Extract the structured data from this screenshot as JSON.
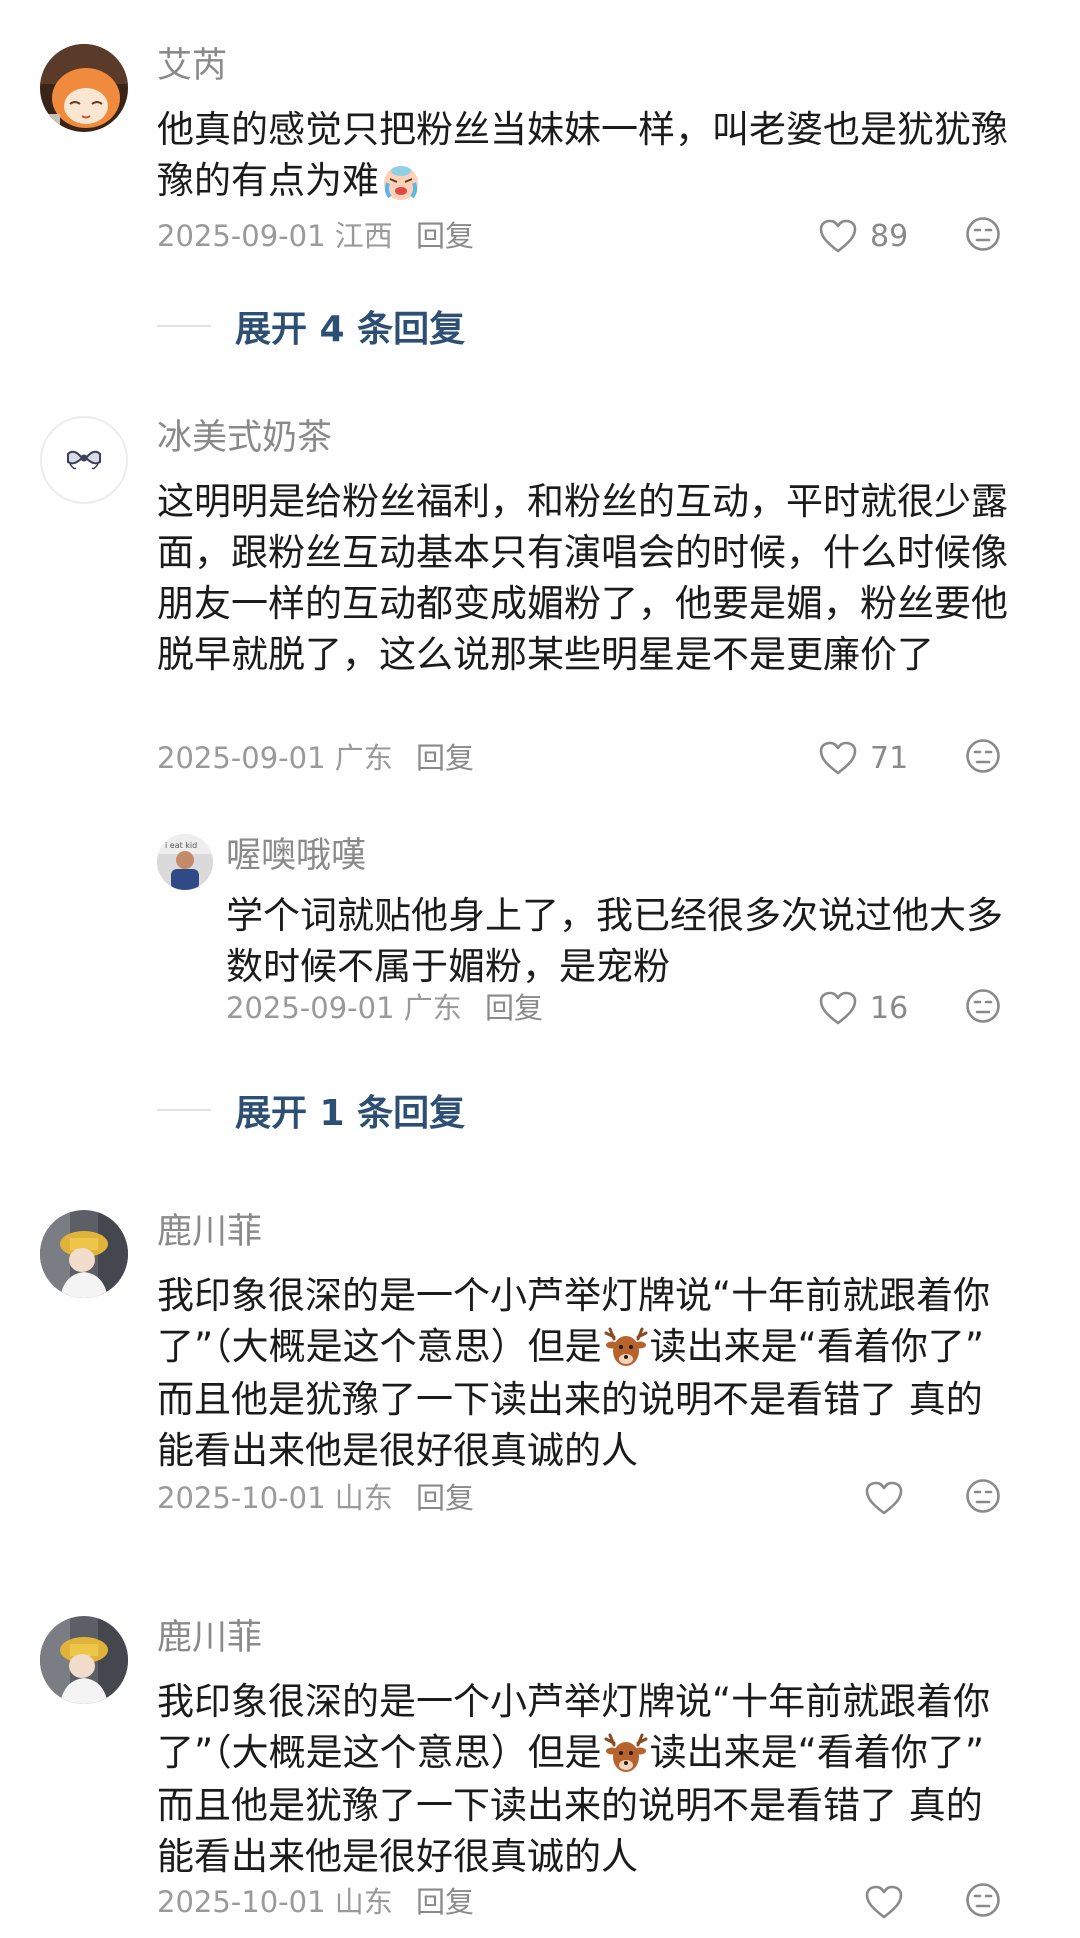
{
  "comments": [
    {
      "username": "艾芮",
      "content_parts": [
        "他真的感觉只把粉丝当妹妹一样，叫老婆也是犹犹豫豫的有点为难"
      ],
      "emoji": "crying-face",
      "date": "2025-09-01",
      "location": "江西",
      "reply_label": "回复",
      "likes": "89",
      "expand_label": "展开 4 条回复"
    },
    {
      "username": "冰美式奶茶",
      "content": "这明明是给粉丝福利，和粉丝的互动，平时就很少露面，跟粉丝互动基本只有演唱会的时候，什么时候像朋友一样的互动都变成媚粉了，他要是媚，粉丝要他脱早就脱了，这么说那某些明星是不是更廉价了",
      "date": "2025-09-01",
      "location": "广东",
      "reply_label": "回复",
      "likes": "71",
      "reply": {
        "username": "喔噢哦嘆",
        "content": "学个词就贴他身上了，我已经很多次说过他大多数时候不属于媚粉，是宠粉",
        "date": "2025-09-01",
        "location": "广东",
        "reply_label": "回复",
        "likes": "16"
      },
      "expand_label": "展开 1 条回复"
    },
    {
      "username": "鹿川菲",
      "content_a": "我印象很深的是一个小芦举灯牌说“十年前就跟着你了”（大概是这个意思）但是",
      "emoji": "deer-face",
      "content_b": "读出来是“看着你了” 而且他是犹豫了一下读出来的说明不是看错了 真的能看出来他是很好很真诚的人",
      "date": "2025-10-01",
      "location": "山东",
      "reply_label": "回复",
      "likes": ""
    },
    {
      "username": "鹿川菲",
      "content_a": "我印象很深的是一个小芦举灯牌说“十年前就跟着你了”（大概是这个意思）但是",
      "emoji": "deer-face",
      "content_b": "读出来是“看着你了” 而且他是犹豫了一下读出来的说明不是看错了 真的能看出来他是很好很真诚的人",
      "date": "2025-10-01",
      "location": "山东",
      "reply_label": "回复",
      "likes": ""
    }
  ]
}
